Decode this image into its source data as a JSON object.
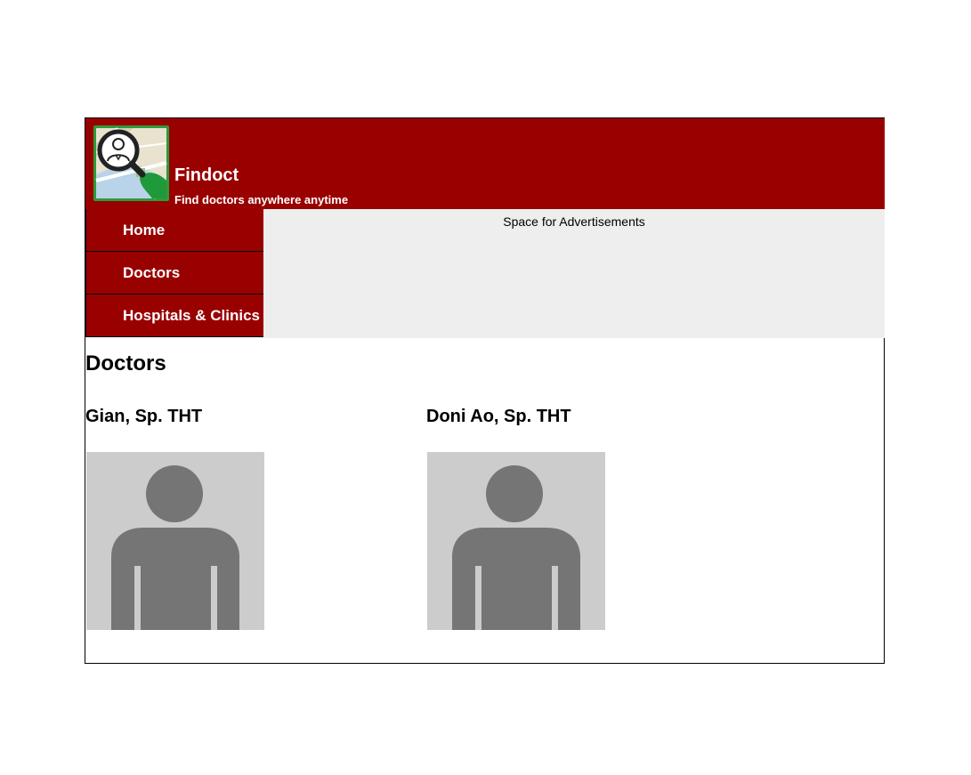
{
  "brand": {
    "name": "Findoct",
    "tagline": "Find doctors anywhere anytime"
  },
  "nav": {
    "items": [
      {
        "label": "Home"
      },
      {
        "label": "Doctors"
      },
      {
        "label": "Hospitals & Clinics"
      }
    ]
  },
  "ad": {
    "label": "Space for Advertisements"
  },
  "main": {
    "title": "Doctors",
    "doctors": [
      {
        "name": "Gian, Sp. THT",
        "photo_icon": "person-placeholder-icon"
      },
      {
        "name": "Doni Ao, Sp. THT",
        "photo_icon": "person-placeholder-icon"
      }
    ]
  },
  "colors": {
    "header_bg": "#990000",
    "nav_bg": "#990000",
    "ad_bg": "#eeeeee",
    "placeholder_bg": "#cccccc",
    "placeholder_fg": "#757575"
  }
}
